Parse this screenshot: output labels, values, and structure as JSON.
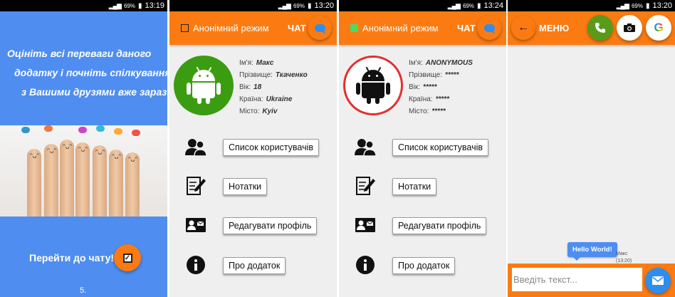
{
  "status_bars": [
    {
      "battery": "69%",
      "time": "13:19"
    },
    {
      "battery": "69%",
      "time": "13:20"
    },
    {
      "battery": "69%",
      "time": "13:24"
    },
    {
      "battery": "69%",
      "time": "13:20"
    }
  ],
  "intro": {
    "promo_lines": [
      "Оцініть всі переваги даного",
      "додатку і почніть спілкування",
      "з Вашими друзями вже зараз!"
    ],
    "go_to_chat": "Перейти до чату!",
    "page_number": "5."
  },
  "profile": {
    "anon_label": "Анонімний режим",
    "chat_label": "ЧАТ",
    "fields": [
      {
        "label": "Ім'я:",
        "value": "Макс"
      },
      {
        "label": "Прізвище:",
        "value": "Ткаченко"
      },
      {
        "label": "Вік:",
        "value": "18"
      },
      {
        "label": "Країна:",
        "value": "Ukraine"
      },
      {
        "label": "Місто:",
        "value": "Kyiv"
      }
    ],
    "menu": [
      {
        "label": "Список користувачів",
        "icon": "users-icon"
      },
      {
        "label": "Нотатки",
        "icon": "notes-icon"
      },
      {
        "label": "Редагувати профіль",
        "icon": "profile-card-icon"
      },
      {
        "label": "Про додаток",
        "icon": "info-icon"
      }
    ]
  },
  "anon_profile": {
    "anon_label": "Анонімний режим",
    "chat_label": "ЧАТ",
    "fields": [
      {
        "label": "Ім'я:",
        "value": "ANONYMOUS"
      },
      {
        "label": "Прізвище:",
        "value": "*****"
      },
      {
        "label": "Вік:",
        "value": "*****"
      },
      {
        "label": "Країна:",
        "value": "*****"
      },
      {
        "label": "Місто:",
        "value": "*****"
      }
    ],
    "menu": [
      {
        "label": "Список користувачів"
      },
      {
        "label": "Нотатки"
      },
      {
        "label": "Редагувати профіль"
      },
      {
        "label": "Про додаток"
      }
    ]
  },
  "chat": {
    "menu_label": "МЕНЮ",
    "message": "Hello World!",
    "sender_name": "Макс",
    "sender_time": "(13:20)",
    "input_placeholder": "Введіть текст..."
  },
  "colors": {
    "accent_orange": "#fb7b12",
    "intro_blue": "#4f8ef0",
    "android_green": "#3b9c12",
    "anon_red": "#e23030",
    "send_blue": "#2d8ef0"
  }
}
